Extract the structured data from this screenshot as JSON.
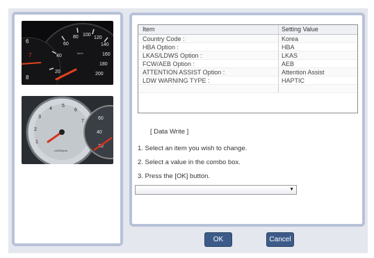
{
  "table": {
    "headers": {
      "item": "Item",
      "value": "Setting Value"
    },
    "rows": [
      {
        "item": "Country Code :",
        "value": "Korea"
      },
      {
        "item": "HBA Option :",
        "value": "HBA"
      },
      {
        "item": "LKAS/LDWS Option :",
        "value": "LKAS"
      },
      {
        "item": "FCW/AEB Option :",
        "value": "AEB"
      },
      {
        "item": "ATTENTION ASSIST Option :",
        "value": "Attention Assist"
      },
      {
        "item": "LDW WARNING TYPE :",
        "value": "HAPTIC"
      }
    ]
  },
  "instructions": {
    "heading": "[ Data Write ]",
    "step1": "1. Select an item you wish to change.",
    "step2": "2. Select a value in the combo box.",
    "step3": "3. Press the [OK] button."
  },
  "combo": {
    "value": ""
  },
  "buttons": {
    "ok": "OK",
    "cancel": "Cancel"
  },
  "colors": {
    "panel_border": "#b7c1d8",
    "button": "#3c5b89",
    "background": "#e4e7ed"
  }
}
